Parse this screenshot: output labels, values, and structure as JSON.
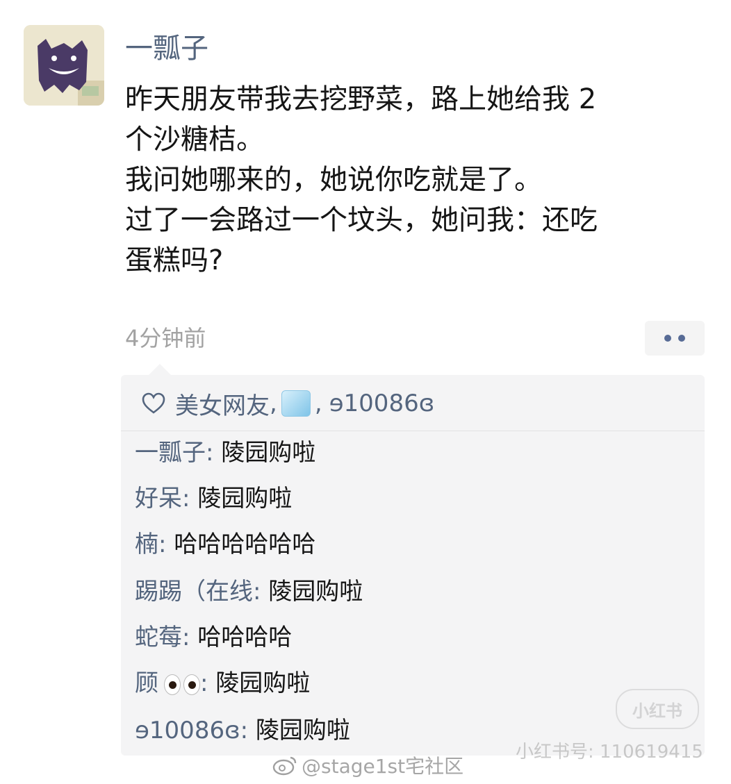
{
  "post": {
    "author": "一瓢子",
    "lines": [
      "昨天朋友带我去挖野菜，路上她给我 2",
      "个沙糖桔。",
      "我问她哪来的，她说你吃就是了。",
      "过了一会路过一个坟头，她问我：还吃",
      "蛋糕吗?"
    ],
    "timestamp": "4分钟前"
  },
  "likes": {
    "names": [
      "美女网友",
      "ɘ10086ɞ"
    ],
    "separator": ",",
    "icons": [
      "heart-outline-icon",
      "ice-cube-emoji"
    ]
  },
  "comments": [
    {
      "name": "一瓢子",
      "text": "陵园购啦"
    },
    {
      "name": "好呆",
      "text": "陵园购啦"
    },
    {
      "name": "楠",
      "text": "哈哈哈哈哈哈"
    },
    {
      "name": "踢踢（在线",
      "text": "陵园购啦"
    },
    {
      "name": "蛇莓",
      "text": "哈哈哈哈"
    },
    {
      "name": "顾",
      "text": "陵园购啦",
      "emoji": "eyes-emoji"
    },
    {
      "name": "ɘ10086ɞ",
      "text": "陵园购啦"
    }
  ],
  "comment_separator": ": ",
  "watermarks": {
    "badge": "小红书",
    "id": "小红书号: 110619415",
    "weibo": "@stage1st宅社区"
  },
  "colors": {
    "name_blue": "#54657e",
    "text": "#151515",
    "timestamp": "#a2a2a2",
    "comment_bg": "#f4f4f5"
  }
}
